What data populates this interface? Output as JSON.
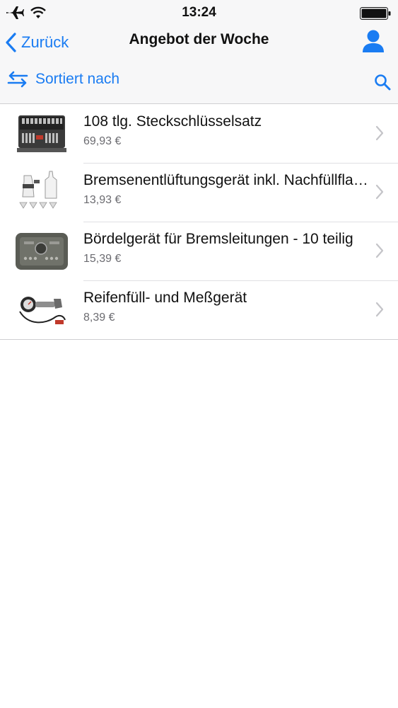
{
  "status": {
    "time": "13:24"
  },
  "nav": {
    "back_label": "Zurück",
    "title": "Angebot der Woche"
  },
  "toolbar": {
    "sort_label": "Sortiert nach"
  },
  "products": [
    {
      "title": "108 tlg. Steckschlüsselsatz",
      "price": "69,93 €"
    },
    {
      "title": "Bremsenentlüftungsgerät inkl. Nachfüllflasche",
      "price": "13,93 €"
    },
    {
      "title": "Bördelgerät für Bremsleitungen - 10 teilig",
      "price": "15,39 €"
    },
    {
      "title": "Reifenfüll- und Meßgerät",
      "price": "8,39 €"
    }
  ],
  "colors": {
    "accent": "#1a7cf2",
    "bar_bg": "#f7f7f8"
  }
}
